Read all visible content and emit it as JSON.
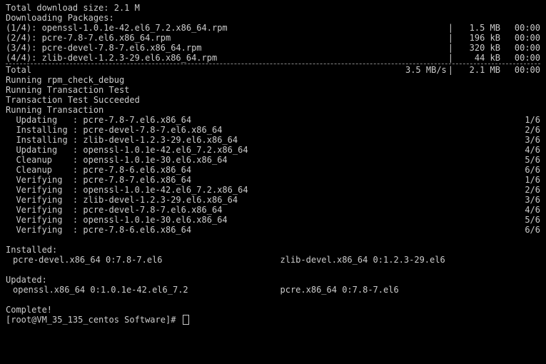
{
  "header": {
    "total_dl": "Total download size: 2.1 M",
    "dl_pkgs": "Downloading Packages:"
  },
  "downloads": [
    {
      "n": "(1/4): openssl-1.0.1e-42.el6_7.2.x86_64.rpm",
      "size": "1.5 MB",
      "time": "00:00"
    },
    {
      "n": "(2/4): pcre-7.8-7.el6.x86_64.rpm",
      "size": "196 kB",
      "time": "00:00"
    },
    {
      "n": "(3/4): pcre-devel-7.8-7.el6.x86_64.rpm",
      "size": "320 kB",
      "time": "00:00"
    },
    {
      "n": "(4/4): zlib-devel-1.2.3-29.el6.x86_64.rpm",
      "size": "44 kB",
      "time": "00:00"
    }
  ],
  "total_row": {
    "label": "Total",
    "rate": "3.5 MB/s",
    "size": "2.1 MB",
    "time": "00:00"
  },
  "progress_msgs": [
    "Running rpm_check_debug",
    "Running Transaction Test",
    "Transaction Test Succeeded",
    "Running Transaction"
  ],
  "trans": [
    {
      "act": "Updating  ",
      "pkg": "pcre-7.8-7.el6.x86_64",
      "idx": "1/6"
    },
    {
      "act": "Installing",
      "pkg": "pcre-devel-7.8-7.el6.x86_64",
      "idx": "2/6"
    },
    {
      "act": "Installing",
      "pkg": "zlib-devel-1.2.3-29.el6.x86_64",
      "idx": "3/6"
    },
    {
      "act": "Updating  ",
      "pkg": "openssl-1.0.1e-42.el6_7.2.x86_64",
      "idx": "4/6"
    },
    {
      "act": "Cleanup   ",
      "pkg": "openssl-1.0.1e-30.el6.x86_64",
      "idx": "5/6"
    },
    {
      "act": "Cleanup   ",
      "pkg": "pcre-7.8-6.el6.x86_64",
      "idx": "6/6"
    },
    {
      "act": "Verifying ",
      "pkg": "pcre-7.8-7.el6.x86_64",
      "idx": "1/6"
    },
    {
      "act": "Verifying ",
      "pkg": "openssl-1.0.1e-42.el6_7.2.x86_64",
      "idx": "2/6"
    },
    {
      "act": "Verifying ",
      "pkg": "zlib-devel-1.2.3-29.el6.x86_64",
      "idx": "3/6"
    },
    {
      "act": "Verifying ",
      "pkg": "pcre-devel-7.8-7.el6.x86_64",
      "idx": "4/6"
    },
    {
      "act": "Verifying ",
      "pkg": "openssl-1.0.1e-30.el6.x86_64",
      "idx": "5/6"
    },
    {
      "act": "Verifying ",
      "pkg": "pcre-7.8-6.el6.x86_64",
      "idx": "6/6"
    }
  ],
  "installed_hdr": "Installed:",
  "installed": [
    "pcre-devel.x86_64 0:7.8-7.el6",
    "zlib-devel.x86_64 0:1.2.3-29.el6"
  ],
  "updated_hdr": "Updated:",
  "updated": [
    "openssl.x86_64 0:1.0.1e-42.el6_7.2",
    "pcre.x86_64 0:7.8-7.el6"
  ],
  "complete": "Complete!",
  "prompt": "[root@VM_35_135_centos Software]# "
}
